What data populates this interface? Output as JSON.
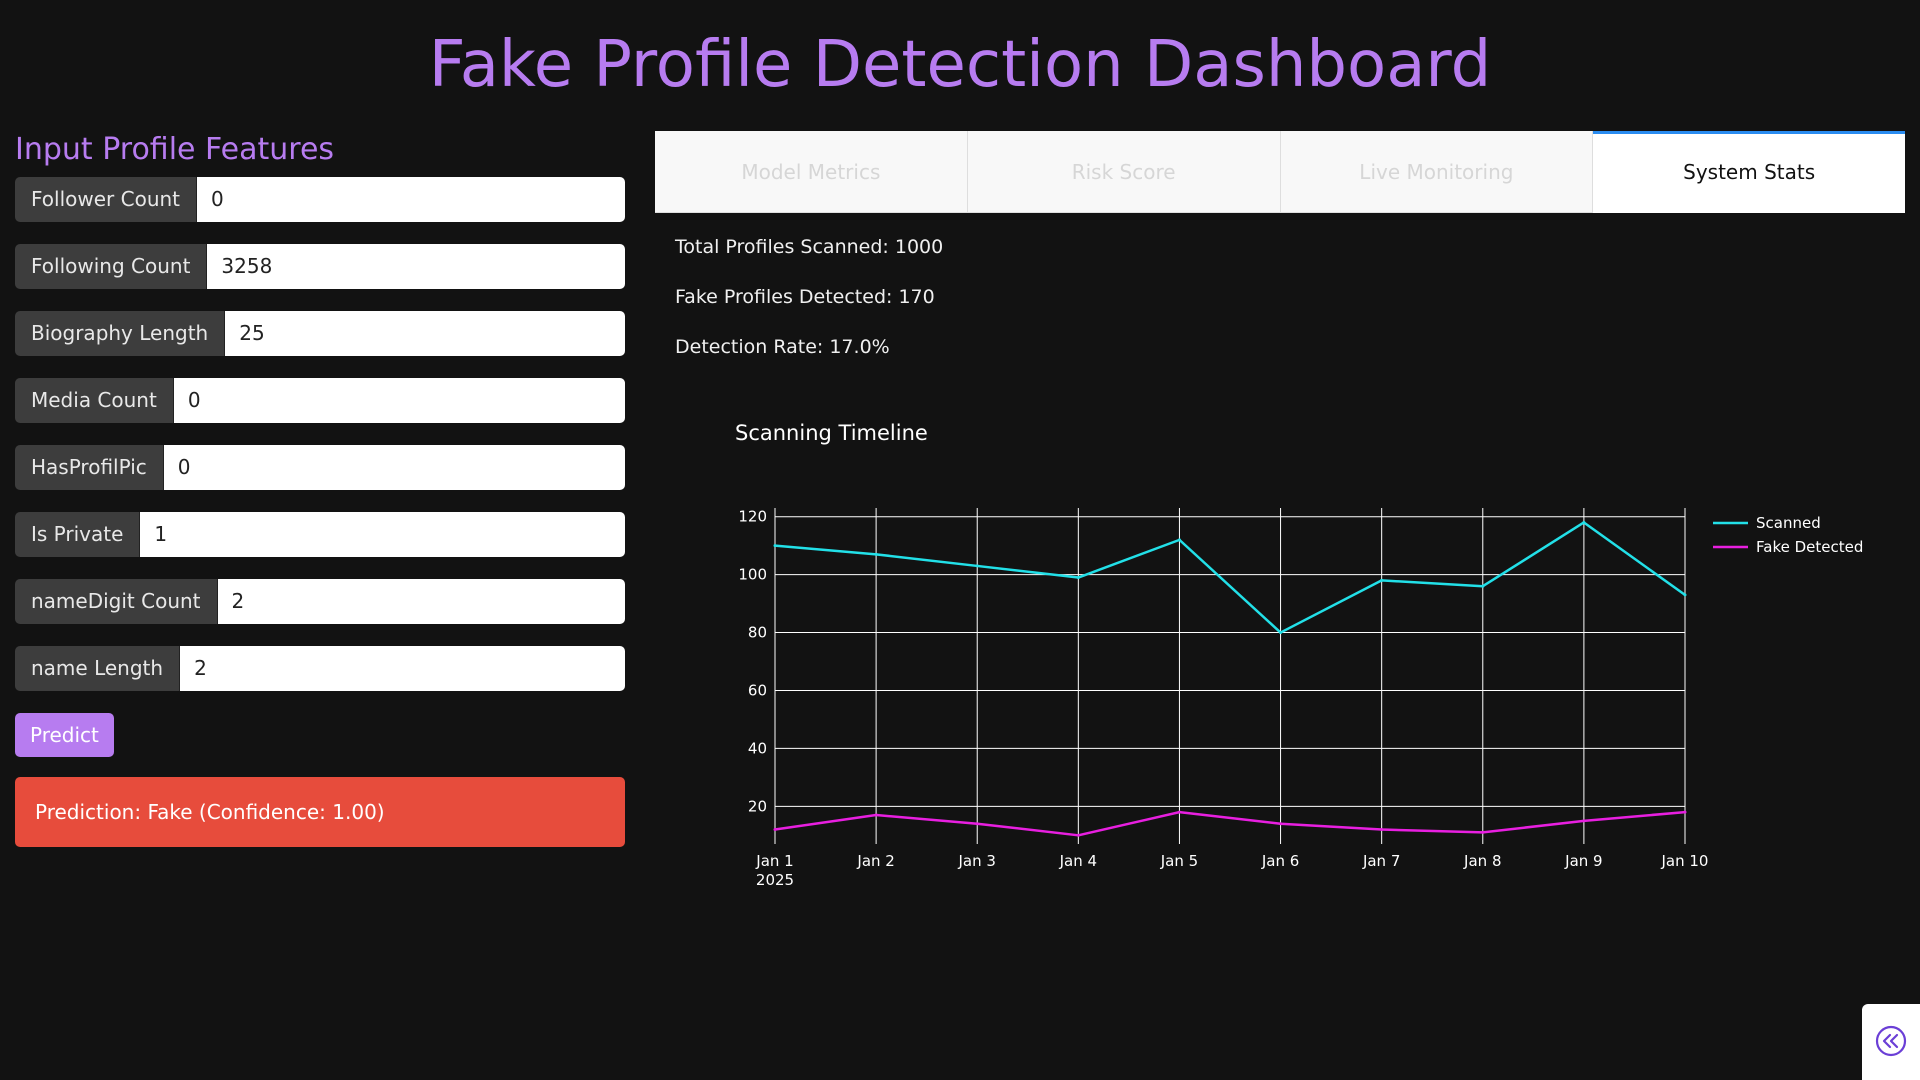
{
  "page_title": "Fake Profile Detection Dashboard",
  "input_panel": {
    "heading": "Input Profile Features",
    "fields": [
      {
        "label": "Follower Count",
        "value": "0"
      },
      {
        "label": "Following Count",
        "value": "3258"
      },
      {
        "label": "Biography Length",
        "value": "25"
      },
      {
        "label": "Media Count",
        "value": "0"
      },
      {
        "label": "HasProfilPic",
        "value": "0"
      },
      {
        "label": "Is Private",
        "value": "1"
      },
      {
        "label": "nameDigit Count",
        "value": "2"
      },
      {
        "label": "name Length",
        "value": "2"
      }
    ],
    "predict_label": "Predict",
    "result_text": "Prediction: Fake (Confidence: 1.00)"
  },
  "tabs": [
    {
      "label": "Model Metrics"
    },
    {
      "label": "Risk Score"
    },
    {
      "label": "Live Monitoring"
    },
    {
      "label": "System Stats"
    }
  ],
  "active_tab": "System Stats",
  "stats": {
    "total": "Total Profiles Scanned: 1000",
    "fake": "Fake Profiles Detected: 170",
    "rate": "Detection Rate: 17.0%"
  },
  "colors": {
    "accent": "#b77cf0",
    "danger": "#e74c3c",
    "scanned": "#22e0e8",
    "fake": "#e81fe0"
  },
  "icons": {
    "collapse": "double-chevron-left-icon"
  },
  "chart_data": {
    "type": "line",
    "title": "Scanning Timeline",
    "x": [
      "Jan 1",
      "Jan 2",
      "Jan 3",
      "Jan 4",
      "Jan 5",
      "Jan 6",
      "Jan 7",
      "Jan 8",
      "Jan 9",
      "Jan 10"
    ],
    "x_year_label": "2025",
    "yticks": [
      20,
      40,
      60,
      80,
      100,
      120
    ],
    "ylim": [
      7,
      123
    ],
    "series": [
      {
        "name": "Scanned",
        "values": [
          110,
          107,
          103,
          99,
          112,
          80,
          98,
          96,
          118,
          93
        ]
      },
      {
        "name": "Fake Detected",
        "values": [
          12,
          17,
          14,
          10,
          18,
          14,
          12,
          11,
          15,
          18
        ]
      }
    ],
    "grid": true,
    "legend": "top-right"
  }
}
